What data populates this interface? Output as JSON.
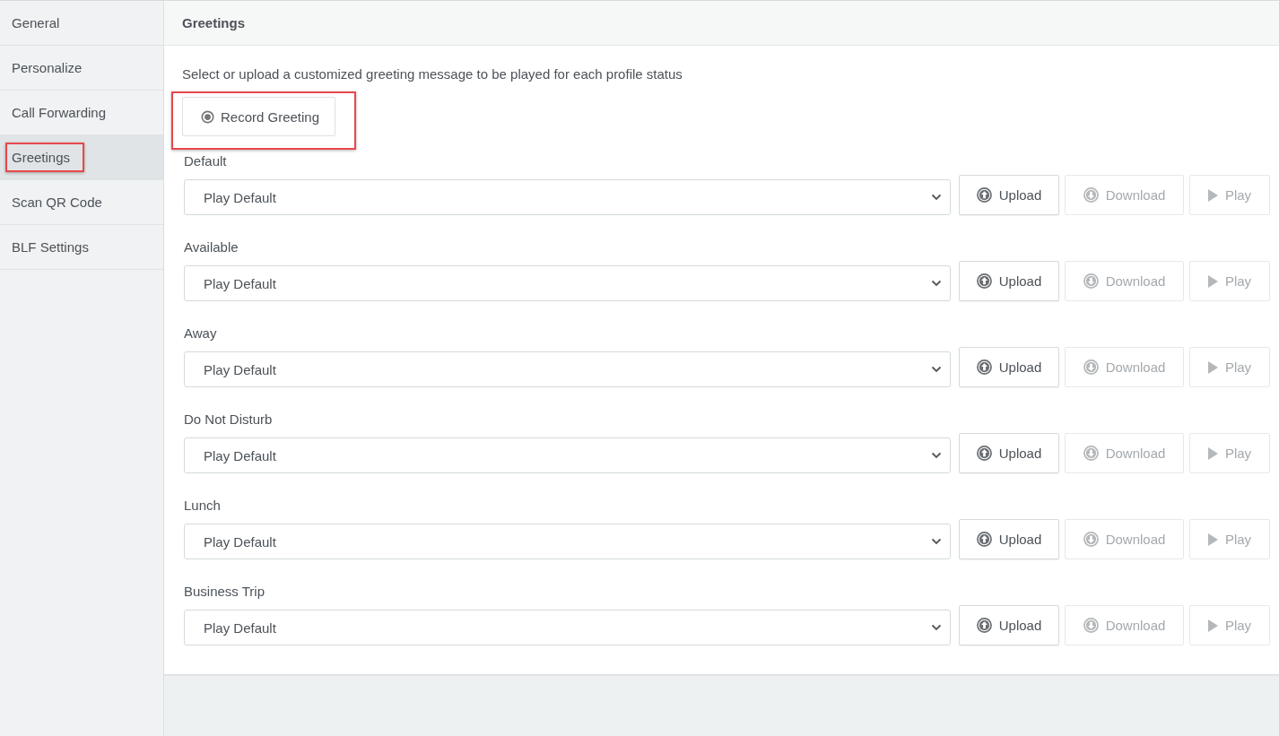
{
  "sidebar": {
    "items": [
      {
        "label": "General",
        "selected": false,
        "highlighted": false
      },
      {
        "label": "Personalize",
        "selected": false,
        "highlighted": false
      },
      {
        "label": "Call Forwarding",
        "selected": false,
        "highlighted": false
      },
      {
        "label": "Greetings",
        "selected": true,
        "highlighted": true
      },
      {
        "label": "Scan QR Code",
        "selected": false,
        "highlighted": false
      },
      {
        "label": "BLF Settings",
        "selected": false,
        "highlighted": false
      }
    ]
  },
  "panel": {
    "title": "Greetings",
    "description": "Select or upload a customized greeting message to be played for each profile status",
    "record_button": {
      "label": "Record Greeting",
      "highlighted": true
    },
    "greetings": [
      {
        "label": "Default",
        "value": "Play Default",
        "buttons": [
          {
            "kind": "upload",
            "label": "Upload",
            "disabled": false
          },
          {
            "kind": "download",
            "label": "Download",
            "disabled": true
          },
          {
            "kind": "play",
            "label": "Play",
            "disabled": true
          }
        ]
      },
      {
        "label": "Available",
        "value": "Play Default",
        "buttons": [
          {
            "kind": "upload",
            "label": "Upload",
            "disabled": false
          },
          {
            "kind": "download",
            "label": "Download",
            "disabled": true
          },
          {
            "kind": "play",
            "label": "Play",
            "disabled": true
          }
        ]
      },
      {
        "label": "Away",
        "value": "Play Default",
        "buttons": [
          {
            "kind": "upload",
            "label": "Upload",
            "disabled": false
          },
          {
            "kind": "download",
            "label": "Download",
            "disabled": true
          },
          {
            "kind": "play",
            "label": "Play",
            "disabled": true
          }
        ]
      },
      {
        "label": "Do Not Disturb",
        "value": "Play Default",
        "buttons": [
          {
            "kind": "upload",
            "label": "Upload",
            "disabled": false
          },
          {
            "kind": "download",
            "label": "Download",
            "disabled": true
          },
          {
            "kind": "play",
            "label": "Play",
            "disabled": true
          }
        ]
      },
      {
        "label": "Lunch",
        "value": "Play Default",
        "buttons": [
          {
            "kind": "upload",
            "label": "Upload",
            "disabled": false
          },
          {
            "kind": "download",
            "label": "Download",
            "disabled": true
          },
          {
            "kind": "play",
            "label": "Play",
            "disabled": true
          }
        ]
      },
      {
        "label": "Business Trip",
        "value": "Play Default",
        "buttons": [
          {
            "kind": "upload",
            "label": "Upload",
            "disabled": false
          },
          {
            "kind": "download",
            "label": "Download",
            "disabled": true
          },
          {
            "kind": "play",
            "label": "Play",
            "disabled": true
          }
        ]
      }
    ]
  }
}
